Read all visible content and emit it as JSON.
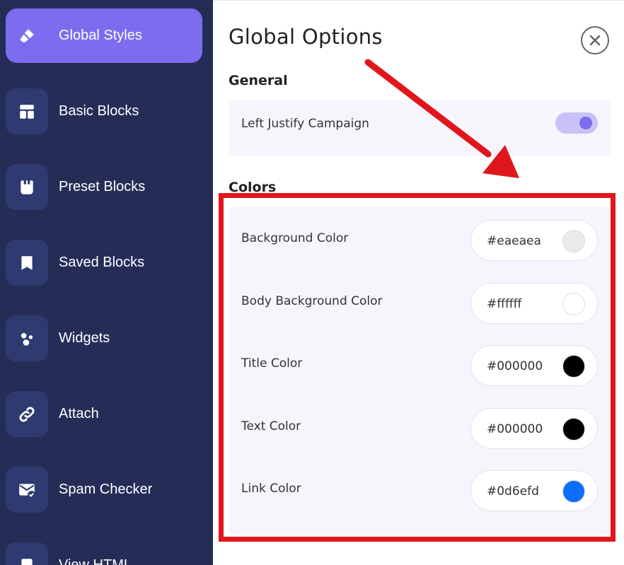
{
  "sidebar": {
    "items": [
      {
        "label": "Global Styles",
        "icon": "brush-icon",
        "active": true
      },
      {
        "label": "Basic Blocks",
        "icon": "layout-icon",
        "active": false
      },
      {
        "label": "Preset Blocks",
        "icon": "preset-icon",
        "active": false
      },
      {
        "label": "Saved Blocks",
        "icon": "bookmark-icon",
        "active": false
      },
      {
        "label": "Widgets",
        "icon": "dots-icon",
        "active": false
      },
      {
        "label": "Attach",
        "icon": "link-icon",
        "active": false
      },
      {
        "label": "Spam Checker",
        "icon": "mail-check-icon",
        "active": false
      },
      {
        "label": "View HTML",
        "icon": "file-icon",
        "active": false
      }
    ]
  },
  "panel": {
    "title": "Global Options",
    "general": {
      "heading": "General",
      "left_justify_label": "Left Justify Campaign",
      "left_justify_on": true
    },
    "colors": {
      "heading": "Colors",
      "items": [
        {
          "label": "Background Color",
          "value": "#eaeaea",
          "swatch": "#eaeaea"
        },
        {
          "label": "Body Background Color",
          "value": "#ffffff",
          "swatch": "#ffffff"
        },
        {
          "label": "Title Color",
          "value": "#000000",
          "swatch": "#000000"
        },
        {
          "label": "Text Color",
          "value": "#000000",
          "swatch": "#000000"
        },
        {
          "label": "Link Color",
          "value": "#0d6efd",
          "swatch": "#0d6efd"
        }
      ]
    }
  },
  "colors": {
    "sidebar_bg": "#252d57",
    "accent": "#7b6cf0",
    "annotation_red": "#e0161c"
  }
}
